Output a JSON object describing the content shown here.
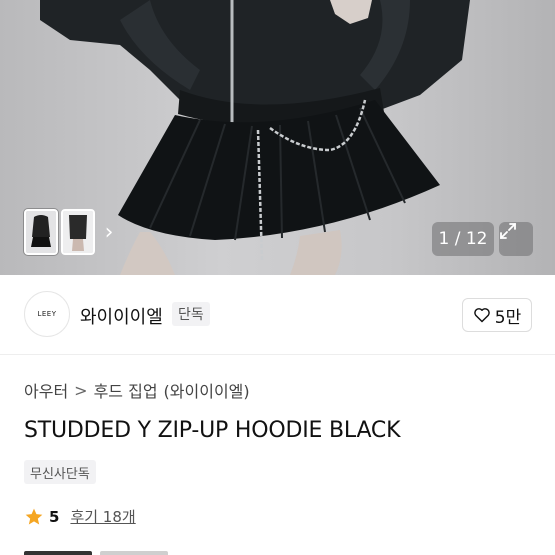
{
  "gallery": {
    "counter": "1 / 12",
    "next_arrow": "›"
  },
  "brand": {
    "logo_text": "LEEY",
    "name": "와이이이엘",
    "tag": "단독",
    "likes": "5만"
  },
  "breadcrumb": {
    "category": "아우터",
    "subcategory": "후드 집업",
    "brand": "(와이이이엘)",
    "separator": ">"
  },
  "product": {
    "title": "STUDDED Y ZIP-UP HOODIE BLACK",
    "badge": "무신사단독",
    "rating": "5",
    "reviews": "후기 18개"
  },
  "colors": {
    "star": "#F5A623",
    "garment": "#1c1f22"
  },
  "icons": [
    "heart-icon",
    "expand-icon",
    "star-icon",
    "chevron-right-icon"
  ]
}
